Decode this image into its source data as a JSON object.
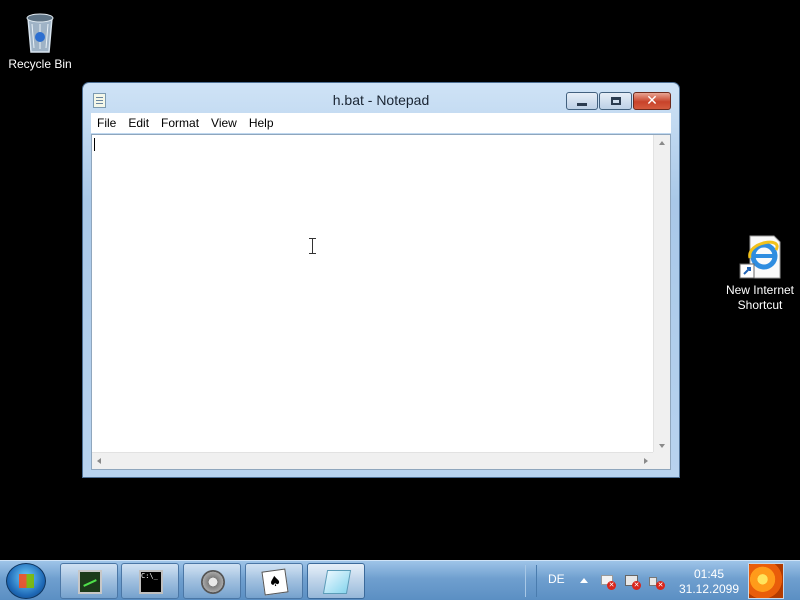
{
  "desktop": {
    "icons": [
      {
        "label": "Recycle Bin",
        "icon": "recycle-bin-icon"
      },
      {
        "label": "New Internet Shortcut",
        "icon": "internet-explorer-icon"
      }
    ]
  },
  "window": {
    "title": "h.bat - Notepad",
    "menu": [
      "File",
      "Edit",
      "Format",
      "View",
      "Help"
    ],
    "content": ""
  },
  "taskbar": {
    "buttons": [
      {
        "name": "task-manager",
        "icon": "task-manager-icon"
      },
      {
        "name": "command-prompt",
        "icon": "cmd-icon",
        "text": "C:\\_"
      },
      {
        "name": "settings-tool",
        "icon": "gear-icon"
      },
      {
        "name": "solitaire",
        "icon": "cards-icon",
        "text": "♠"
      },
      {
        "name": "notepad",
        "icon": "notepad-icon",
        "active": true
      }
    ],
    "tray": {
      "language": "DE",
      "time": "01:45",
      "date": "31.12.2099"
    }
  },
  "colors": {
    "desktop_background": "#000000",
    "window_frame": "#b8d3ef",
    "taskbar": "#6f9fcf"
  }
}
